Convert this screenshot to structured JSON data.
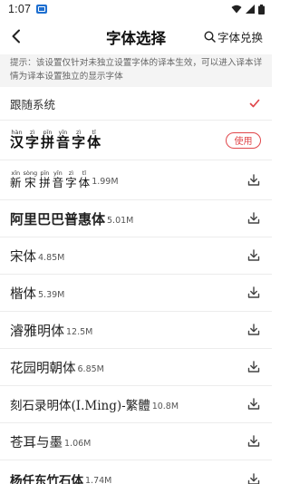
{
  "status": {
    "time": "1:07"
  },
  "header": {
    "title": "字体选择",
    "redeem_label": "字体兑换"
  },
  "tip": "提示：该设置仅针对未独立设置字体的译本生效，可以进入译本详情为译本设置独立的显示字体",
  "fonts": [
    {
      "name": "跟随系统",
      "size": "",
      "action": "selected"
    },
    {
      "name": "汉字拼音字体",
      "pinyin": [
        "hàn",
        "zì",
        "pīn",
        "yīn",
        "zì",
        "tǐ"
      ],
      "size": "",
      "action": "使用"
    },
    {
      "name": "新宋拼音字体",
      "pinyin": [
        "xīn",
        "sòng",
        "pīn",
        "yīn",
        "zì",
        "tǐ"
      ],
      "size": "1.99M",
      "action": "download"
    },
    {
      "name": "阿里巴巴普惠体",
      "size": "5.01M",
      "action": "download"
    },
    {
      "name": "宋体",
      "size": "4.85M",
      "action": "download"
    },
    {
      "name": "楷体",
      "size": "5.39M",
      "action": "download"
    },
    {
      "name": "濬雅明体",
      "size": "12.5M",
      "action": "download"
    },
    {
      "name": "花园明朝体",
      "size": "6.85M",
      "action": "download"
    },
    {
      "name": "刻石录明体(I.Ming)-繁體",
      "size": "10.8M",
      "action": "download"
    },
    {
      "name": "苍耳与墨",
      "size": "1.06M",
      "action": "download"
    },
    {
      "name": "杨任东竹石体",
      "size": "1.74M",
      "action": "download"
    }
  ],
  "colors": {
    "accent": "#e0464a",
    "tip_bg": "#f4f4f4"
  },
  "icons": {
    "back": "chevron-left-icon",
    "search": "search-icon",
    "check": "check-icon",
    "download": "download-icon"
  }
}
